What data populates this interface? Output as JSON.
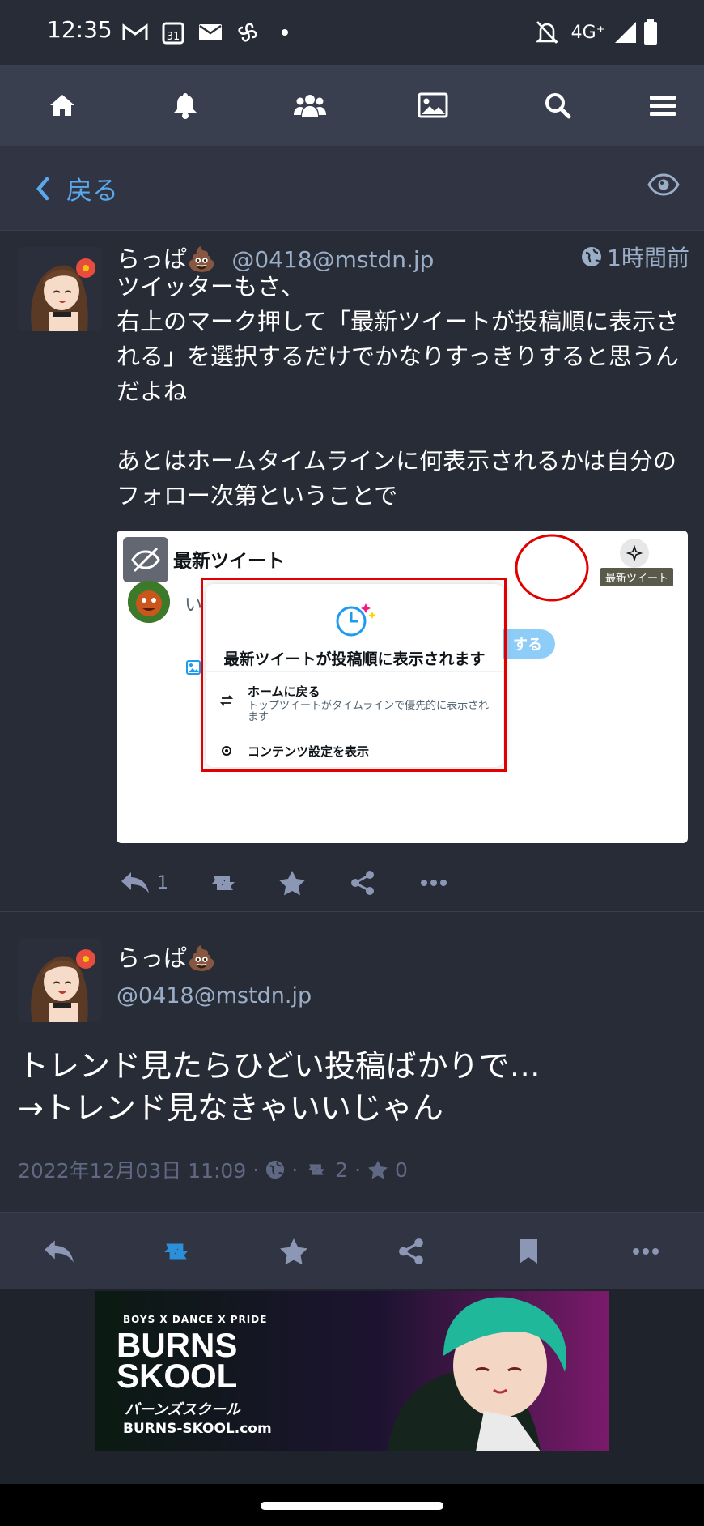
{
  "status_bar": {
    "time": "12:35",
    "network": "4G⁺"
  },
  "nav": {
    "items": [
      "home-icon",
      "bell-icon",
      "people-icon",
      "image-icon",
      "search-icon",
      "menu-icon"
    ]
  },
  "back_bar": {
    "back_label": "戻る"
  },
  "status1": {
    "display_name": "らっぱ💩",
    "acct": "@0418@mstdn.jp",
    "time_ago": "1時間前",
    "content": "ツイッターもさ、\n右上のマーク押して「最新ツイートが投稿順に表示される」を選択するだけでかなりすっきりすると思うんだよね\n\nあとはホームタイムラインに何表示されるかは自分のフォロー次第ということで",
    "media": {
      "header_title": "最新ツイート",
      "placeholder": "いま",
      "tooltip": "最新ツイート",
      "post_button": "する",
      "popup_title": "最新ツイートが投稿順に表示されます",
      "option1_title": "ホームに戻る",
      "option1_desc": "トップツイートがタイムラインで優先的に表示されます",
      "option2_title": "コンテンツ設定を表示"
    },
    "reply_count": "1"
  },
  "status2": {
    "display_name": "らっぱ💩",
    "acct": "@0418@mstdn.jp",
    "content": "トレンド見たらひどい投稿ばかりで…\n→トレンド見なきゃいいじゃん",
    "date": "2022年12月03日 11:09",
    "boosts": "2",
    "favs": "0"
  },
  "ad": {
    "tagline": "BOYS X DANCE X PRIDE",
    "brand_line1": "BURNS",
    "brand_line2": "SKOOL",
    "brand_kana": "バーンズスクール",
    "url": "BURNS-SKOOL.com"
  },
  "colors": {
    "bg": "#282c37",
    "nav": "#393f4f",
    "accent": "#5ba7ea",
    "muted": "#9baec8",
    "action": "#8c97b6"
  }
}
